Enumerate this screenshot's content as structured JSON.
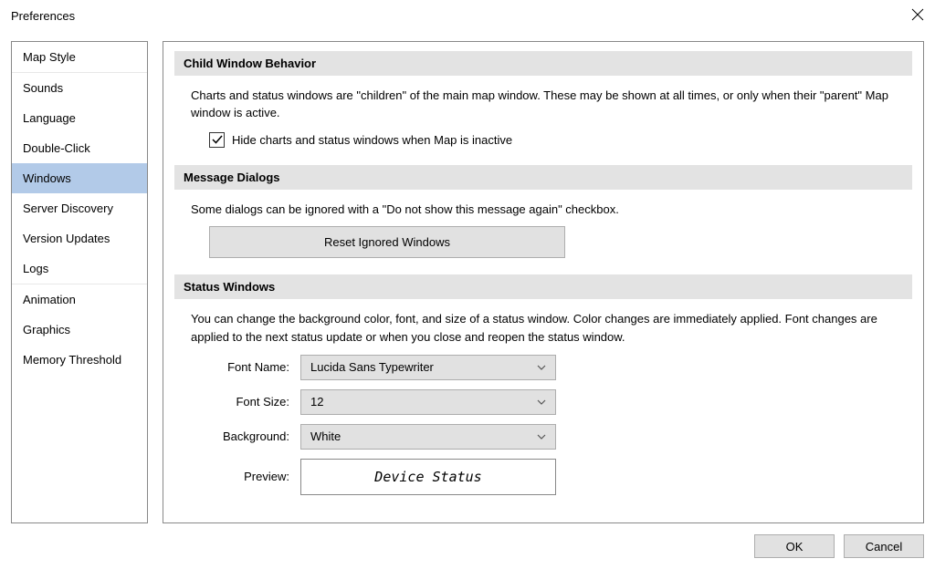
{
  "window": {
    "title": "Preferences"
  },
  "sidebar": {
    "groups": [
      {
        "items": [
          {
            "label": "Map Style"
          }
        ]
      },
      {
        "items": [
          {
            "label": "Sounds"
          },
          {
            "label": "Language"
          },
          {
            "label": "Double-Click"
          },
          {
            "label": "Windows",
            "selected": true
          },
          {
            "label": "Server Discovery"
          },
          {
            "label": "Version Updates"
          },
          {
            "label": "Logs"
          }
        ]
      },
      {
        "items": [
          {
            "label": "Animation"
          },
          {
            "label": "Graphics"
          },
          {
            "label": "Memory Threshold"
          }
        ]
      }
    ]
  },
  "sections": {
    "child_window": {
      "title": "Child Window Behavior",
      "description": "Charts and status windows are \"children\" of the main map window.  These may be shown at all times, or only when their \"parent\" Map window is active.",
      "checkbox_label": "Hide charts and status windows when Map is inactive",
      "checkbox_checked": true
    },
    "message_dialogs": {
      "title": "Message Dialogs",
      "description": "Some dialogs can be ignored with a \"Do not show this message again\" checkbox.",
      "reset_button": "Reset Ignored Windows"
    },
    "status_windows": {
      "title": "Status Windows",
      "description": "You can change the background color, font, and size of a status window. Color changes are immediately applied. Font changes are applied to the next status update or when you close and reopen the status window.",
      "font_name_label": "Font Name:",
      "font_name_value": "Lucida Sans Typewriter",
      "font_size_label": "Font Size:",
      "font_size_value": "12",
      "background_label": "Background:",
      "background_value": "White",
      "preview_label": "Preview:",
      "preview_text": "Device Status"
    }
  },
  "footer": {
    "ok": "OK",
    "cancel": "Cancel"
  }
}
